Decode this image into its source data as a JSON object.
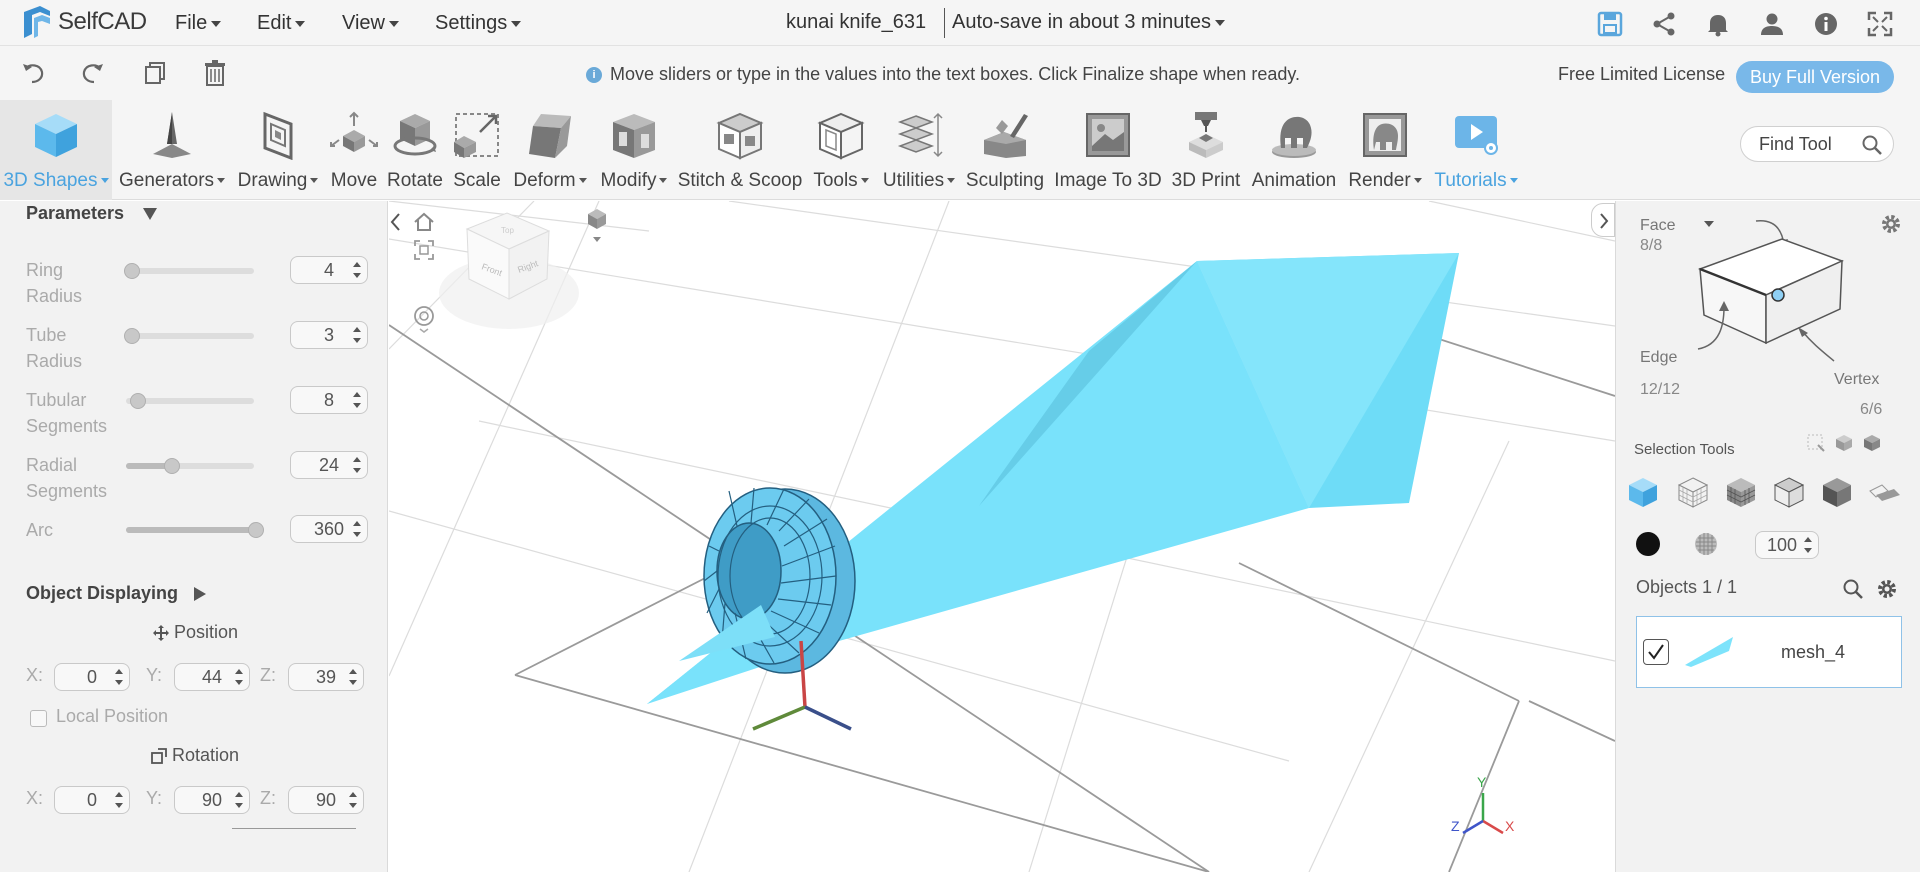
{
  "app": {
    "name": "SelfCAD"
  },
  "menu": [
    {
      "label": "File"
    },
    {
      "label": "Edit"
    },
    {
      "label": "View"
    },
    {
      "label": "Settings"
    }
  ],
  "document": {
    "title": "kunai knife_631",
    "autosave": "Auto-save in about 3 minutes"
  },
  "hint": {
    "text": "Move sliders or type in the values into the text boxes. Click Finalize shape when ready."
  },
  "license": {
    "text": "Free Limited License",
    "buy_label": "Buy Full Version"
  },
  "toolbar": {
    "tools": [
      {
        "label": "3D Shapes",
        "icon": "cube-icon"
      },
      {
        "label": "Generators",
        "icon": "generator-icon"
      },
      {
        "label": "Drawing",
        "icon": "drawing-icon"
      },
      {
        "label": "Move",
        "icon": "move-icon"
      },
      {
        "label": "Rotate",
        "icon": "rotate-icon"
      },
      {
        "label": "Scale",
        "icon": "scale-icon"
      },
      {
        "label": "Deform",
        "icon": "deform-icon"
      },
      {
        "label": "Modify",
        "icon": "modify-icon"
      },
      {
        "label": "Stitch & Scoop",
        "icon": "stitch-icon"
      },
      {
        "label": "Tools",
        "icon": "tools-icon"
      },
      {
        "label": "Utilities",
        "icon": "utilities-icon"
      },
      {
        "label": "Sculpting",
        "icon": "sculpting-icon"
      },
      {
        "label": "Image To 3D",
        "icon": "image-to-3d-icon"
      },
      {
        "label": "3D Print",
        "icon": "print-icon"
      },
      {
        "label": "Animation",
        "icon": "animation-icon"
      },
      {
        "label": "Render",
        "icon": "render-icon"
      },
      {
        "label": "Tutorials",
        "icon": "tutorials-icon"
      }
    ],
    "find_tool": "Find Tool"
  },
  "parameters": {
    "title": "Parameters",
    "items": [
      {
        "label_1": "Ring",
        "label_2": "Radius",
        "value": "4",
        "level": 0.02
      },
      {
        "label_1": "Tube",
        "label_2": "Radius",
        "value": "3",
        "level": 0.02
      },
      {
        "label_1": "Tubular",
        "label_2": "Segments",
        "value": "8",
        "level": 0.07
      },
      {
        "label_1": "Radial",
        "label_2": "Segments",
        "value": "24",
        "level": 0.35
      },
      {
        "label_1": "Arc",
        "label_2": "",
        "value": "360",
        "level": 1.0
      }
    ]
  },
  "object_displaying": {
    "title": "Object Displaying",
    "position_title": "Position",
    "position": {
      "x_label": "X:",
      "x": "0",
      "y_label": "Y:",
      "y": "44",
      "z_label": "Z:",
      "z": "39"
    },
    "local_position": "Local Position",
    "rotation_title": "Rotation",
    "rotation": {
      "x_label": "X:",
      "x": "0",
      "y_label": "Y:",
      "y": "90",
      "z_label": "Z:",
      "z": "90"
    }
  },
  "viewcube": {
    "front": "Front",
    "right": "Right",
    "top": "Top"
  },
  "axes": {
    "x": "X",
    "y": "Y",
    "z": "Z"
  },
  "selection": {
    "face_label": "Face",
    "face_count": "8/8",
    "edge_label": "Edge",
    "edge_count": "12/12",
    "vertex_label": "Vertex",
    "vertex_count": "6/6",
    "tools_title": "Selection Tools",
    "opacity": "100"
  },
  "objects": {
    "title": "Objects 1 / 1",
    "items": [
      {
        "name": "mesh_4",
        "checked": true
      }
    ]
  },
  "colors": {
    "accent": "#4aa3df",
    "model": "#7de3fb",
    "ring": "#6ccbef"
  }
}
